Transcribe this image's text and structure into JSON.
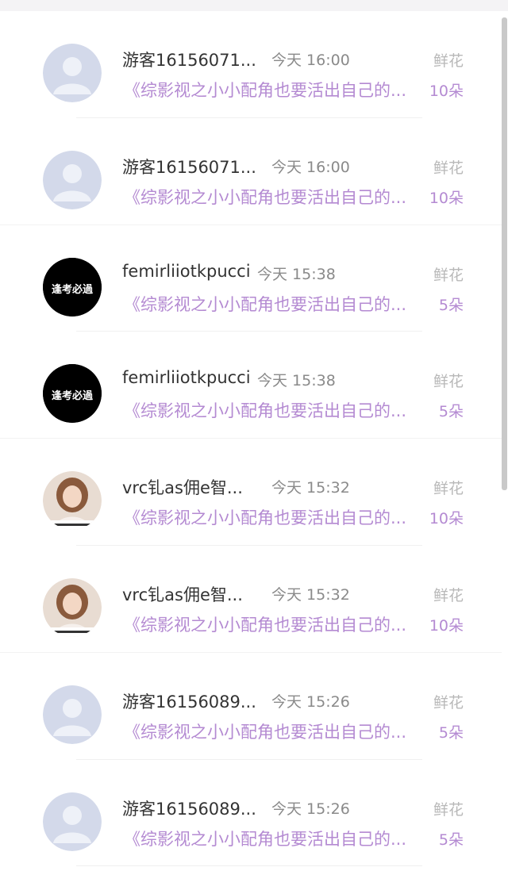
{
  "colors": {
    "accent": "#b48ad2",
    "muted": "#b8b8b8",
    "text": "#333333",
    "time": "#8a8a8a"
  },
  "records": [
    {
      "name": "游客16156071...",
      "time": "今天 16:00",
      "book": "《综影视之小小配角也要活出自己的...",
      "flower_label": "鲜花",
      "count": "10朵",
      "avatar": "default-avatar"
    },
    {
      "name": "游客16156071...",
      "time": "今天 16:00",
      "book": "《综影视之小小配角也要活出自己的...",
      "flower_label": "鲜花",
      "count": "10朵",
      "avatar": "default-avatar"
    },
    {
      "name": "femirliiotkpucci",
      "time": "今天 15:38",
      "book": "《综影视之小小配角也要活出自己的...",
      "flower_label": "鲜花",
      "count": "5朵",
      "avatar": "logo-avatar",
      "avatar_text": "逢考必過"
    },
    {
      "name": "femirliiotkpucci",
      "time": "今天 15:38",
      "book": "《综影视之小小配角也要活出自己的...",
      "flower_label": "鲜花",
      "count": "5朵",
      "avatar": "logo-avatar",
      "avatar_text": "逢考必過"
    },
    {
      "name": "vrc钆as佣e智...",
      "time": "今天 15:32",
      "book": "《综影视之小小配角也要活出自己的...",
      "flower_label": "鲜花",
      "count": "10朵",
      "avatar": "photo-avatar"
    },
    {
      "name": "vrc钆as佣e智...",
      "time": "今天 15:32",
      "book": "《综影视之小小配角也要活出自己的...",
      "flower_label": "鲜花",
      "count": "10朵",
      "avatar": "photo-avatar"
    },
    {
      "name": "游客16156089...",
      "time": "今天 15:26",
      "book": "《综影视之小小配角也要活出自己的...",
      "flower_label": "鲜花",
      "count": "5朵",
      "avatar": "default-avatar"
    },
    {
      "name": "游客16156089...",
      "time": "今天 15:26",
      "book": "《综影视之小小配角也要活出自己的...",
      "flower_label": "鲜花",
      "count": "5朵",
      "avatar": "default-avatar"
    }
  ]
}
